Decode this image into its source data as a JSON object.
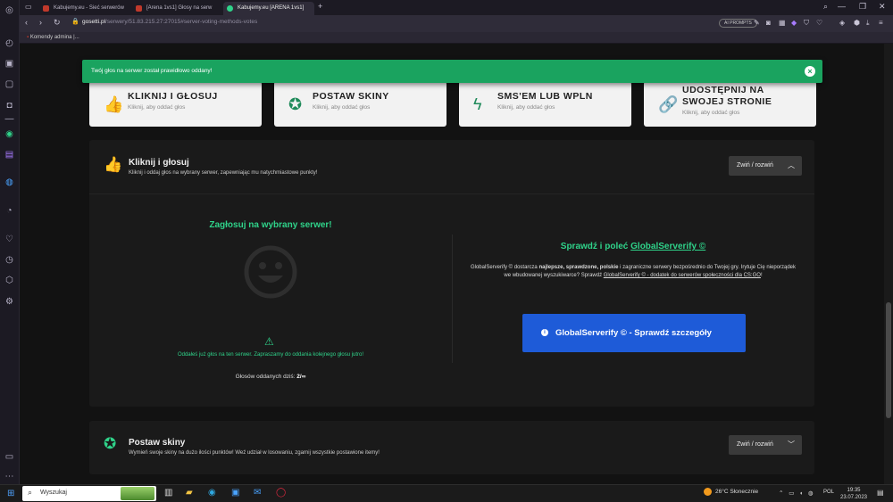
{
  "browser": {
    "tabs": [
      {
        "title": "Kabujemy.eu - Sieć serwerów",
        "color": "#c0392b"
      },
      {
        "title": "[Arena 1vs1] Głosy na serw",
        "color": "#c0392b"
      },
      {
        "title": "Kabujemy.eu [ARENA 1vs1]",
        "color": "#2fd38a"
      }
    ],
    "url_host": "gosetti.pl",
    "url_path": "/serwery/51.83.215.27:27015#server-voting-methods-votes",
    "ai_prompts": "AI PROMPTS",
    "bookmark": "Komendy admina |..."
  },
  "toast": {
    "message": "Twój głos na serwer został prawidłowo oddany!",
    "close": "×"
  },
  "cards": [
    {
      "title": "KLIKNIJ I GŁOSUJ",
      "subtitle": "Kliknij, aby oddać głos",
      "icon": "thumbs-up-icon"
    },
    {
      "title": "POSTAW SKINY",
      "subtitle": "Kliknij, aby oddać głos",
      "icon": "award-icon"
    },
    {
      "title": "SMS'EM LUB WPLN",
      "subtitle": "Kliknij, aby oddać głos",
      "icon": "bolt-icon"
    },
    {
      "title": "UDOSTĘPNIJ NA SWOJEJ STRONIE",
      "title_line1": "UDOSTĘPNIJ NA",
      "title_line2": "SWOJEJ STRONIE",
      "subtitle": "Kliknij, aby oddać głos",
      "icon": "link-icon"
    }
  ],
  "panel1": {
    "title": "Kliknij i głosuj",
    "subtitle": "Kliknij i oddaj głos na wybrany serwer, zapewniając mu natychmiastowe punkty!",
    "toggle": "Zwiń / rozwiń",
    "vote_title": "Zagłosuj na wybrany serwer!",
    "warning": "Oddałeś już głos na ten serwer. Zapraszamy do oddania kolejnego głosu jutro!",
    "count_label": "Głosów oddanych dziś:",
    "count_value": "2/∞",
    "gs_title_prefix": "Sprawdź i poleć",
    "gs_title_link": "GlobalServerify ©",
    "gs_desc_1": "GlobalServerify © dostarcza",
    "gs_desc_bold": "najlepsze, sprawdzone, polskie",
    "gs_desc_2": "i zagraniczne serwery bezpośrednio do Twojej gry. Irytuje Cię nieporządek we wbudowanej wyszukiwarce? Sprawdź",
    "gs_desc_link": "GlobalServerify © - dodatek do serwerów społeczności dla CS:GO",
    "gs_desc_end": "!",
    "gs_button": "GlobalServerify © - Sprawdź szczegóły"
  },
  "panel2": {
    "title": "Postaw skiny",
    "subtitle": "Wymień swoje skiny na dużo ilości punktów! Weź udział w losowaniu, zgarnij wszystkie postawione itemy!",
    "toggle": "Zwiń / rozwiń"
  },
  "taskbar": {
    "search": "Wyszukaj",
    "weather": "26°C  Słonecznie",
    "lang": "POL",
    "time": "19:35",
    "date": "23.07.2023"
  },
  "colors": {
    "accent": "#2fd38a",
    "toast": "#1aa35f",
    "button": "#1e5bd8"
  }
}
